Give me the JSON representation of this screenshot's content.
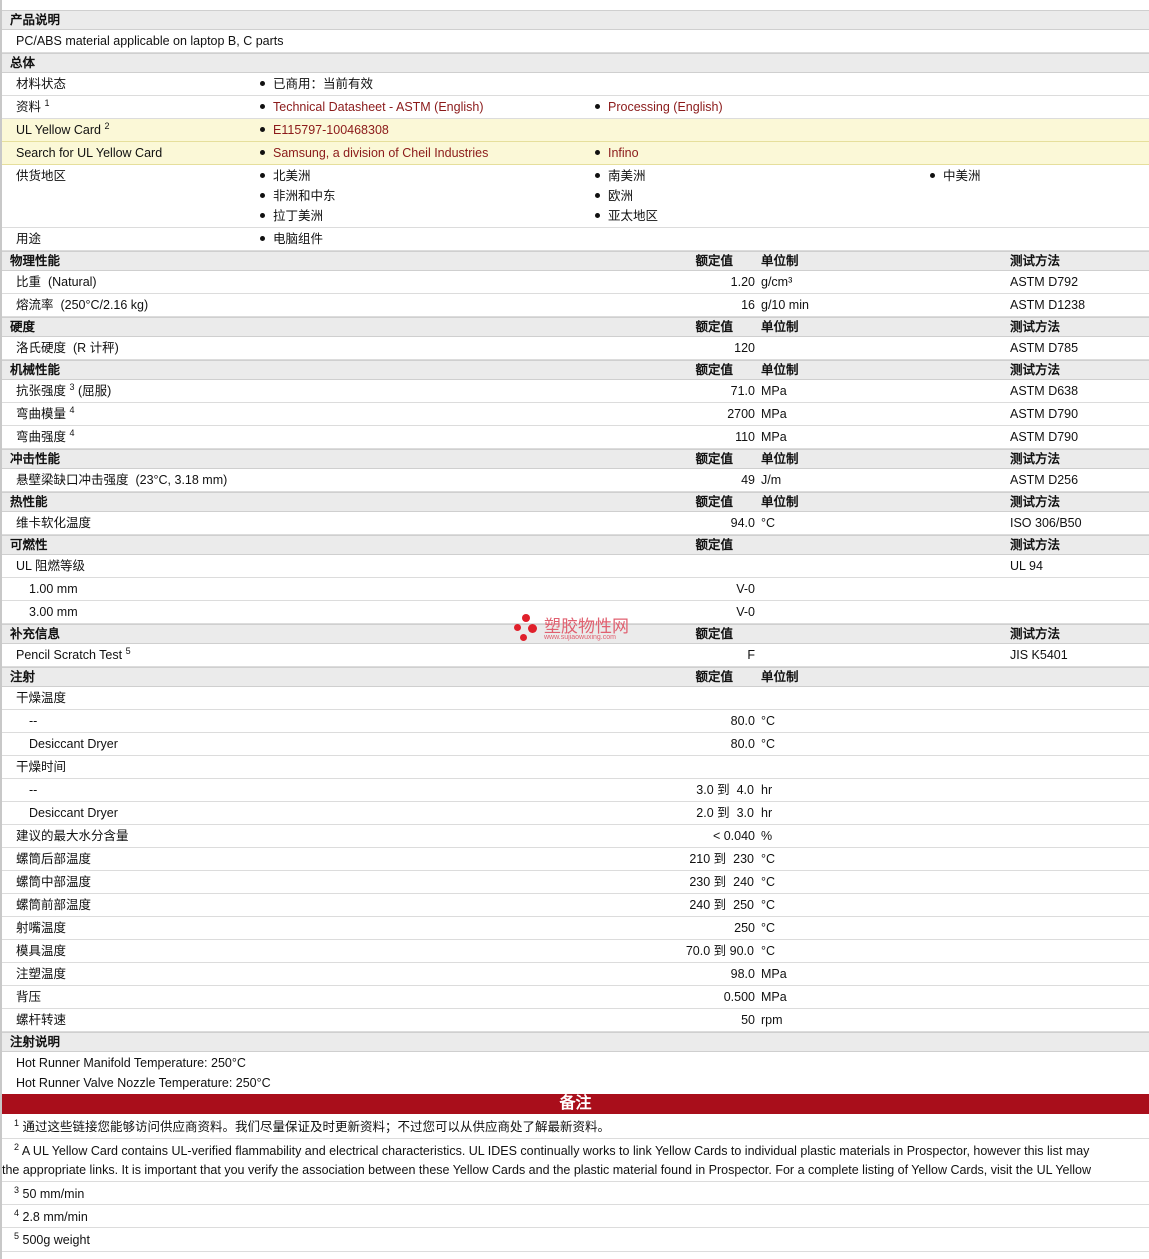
{
  "sections": {
    "desc": "产品说明",
    "general": "总体",
    "physical": "物理性能",
    "hardness": "硬度",
    "mechanical": "机械性能",
    "impact": "冲击性能",
    "thermal": "热性能",
    "flammability": "可燃性",
    "supplement": "补充信息",
    "injection": "注射",
    "injection_notes": "注射说明"
  },
  "headers": {
    "nominal": "额定值",
    "unit": "单位制",
    "method": "测试方法"
  },
  "desc_text": "PC/ABS material applicable on laptop B, C parts",
  "general": {
    "status_label": "材料状态",
    "status_value": "已商用：当前有效",
    "docs_label": "资料",
    "docs_sup": "1",
    "docs_links": [
      "Technical Datasheet - ASTM (English)",
      "Processing (English)"
    ],
    "ul_label": "UL Yellow Card",
    "ul_sup": "2",
    "ul_value": "E115797-100468308",
    "search_label": "Search for UL Yellow Card",
    "search_links": [
      "Samsung, a division of Cheil Industries",
      "Infino"
    ],
    "region_label": "供货地区",
    "regions": [
      "北美洲",
      "南美洲",
      "中美洲",
      "非洲和中东",
      "欧洲",
      "拉丁美洲",
      "亚太地区"
    ],
    "use_label": "用途",
    "use_value": "电脑组件"
  },
  "physical": [
    {
      "label": "比重",
      "cond": "(Natural)",
      "value": "1.20",
      "unit": "g/cm³",
      "method": "ASTM D792"
    },
    {
      "label": "熔流率",
      "cond": "(250°C/2.16 kg)",
      "value": "16",
      "unit": "g/10 min",
      "method": "ASTM D1238"
    }
  ],
  "hardness": [
    {
      "label": "洛氏硬度",
      "cond": "(R 计秤)",
      "value": "120",
      "unit": "",
      "method": "ASTM D785"
    }
  ],
  "mechanical": [
    {
      "label": "抗张强度",
      "sup": "3",
      "cond": "(屈服)",
      "value": "71.0",
      "unit": "MPa",
      "method": "ASTM D638"
    },
    {
      "label": "弯曲模量",
      "sup": "4",
      "value": "2700",
      "unit": "MPa",
      "method": "ASTM D790"
    },
    {
      "label": "弯曲强度",
      "sup": "4",
      "value": "110",
      "unit": "MPa",
      "method": "ASTM D790"
    }
  ],
  "impact": [
    {
      "label": "悬壁梁缺口冲击强度",
      "cond": "(23°C, 3.18 mm)",
      "value": "49",
      "unit": "J/m",
      "method": "ASTM D256"
    }
  ],
  "thermal": [
    {
      "label": "维卡软化温度",
      "value": "94.0",
      "unit": "°C",
      "method": "ISO 306/B50"
    }
  ],
  "flammability": {
    "label": "UL 阻燃等级",
    "method": "UL 94",
    "rows": [
      {
        "label": "1.00 mm",
        "value": "V-0"
      },
      {
        "label": "3.00 mm",
        "value": "V-0"
      }
    ]
  },
  "supplement": [
    {
      "label": "Pencil Scratch Test",
      "sup": "5",
      "value": "F",
      "method": "JIS K5401"
    }
  ],
  "injection": {
    "to": "到",
    "dry_temp_label": "干燥温度",
    "dry_temp": [
      {
        "label": "--",
        "value": "80.0",
        "unit": "°C"
      },
      {
        "label": "Desiccant Dryer",
        "value": "80.0",
        "unit": "°C"
      }
    ],
    "dry_time_label": "干燥时间",
    "dry_time": [
      {
        "label": "--",
        "from": "3.0",
        "upto": "4.0",
        "unit": "hr"
      },
      {
        "label": "Desiccant Dryer",
        "from": "2.0",
        "upto": "3.0",
        "unit": "hr"
      }
    ],
    "moisture": {
      "label": "建议的最大水分含量",
      "value": "< 0.040",
      "unit": "%"
    },
    "rear": {
      "label": "螺筒后部温度",
      "from": "210",
      "upto": "230",
      "unit": "°C"
    },
    "middle": {
      "label": "螺筒中部温度",
      "from": "230",
      "upto": "240",
      "unit": "°C"
    },
    "front": {
      "label": "螺筒前部温度",
      "from": "240",
      "upto": "250",
      "unit": "°C"
    },
    "nozzle": {
      "label": "射嘴温度",
      "value": "250",
      "unit": "°C"
    },
    "mold": {
      "label": "模具温度",
      "from": "70.0",
      "upto": "90.0",
      "unit": "°C"
    },
    "pressure": {
      "label": "注塑温度",
      "value": "98.0",
      "unit": "MPa"
    },
    "back": {
      "label": "背压",
      "value": "0.500",
      "unit": "MPa"
    },
    "speed": {
      "label": "螺杆转速",
      "value": "50",
      "unit": "rpm"
    }
  },
  "injection_notes": [
    "Hot Runner Manifold Temperature: 250°C",
    "Hot Runner Valve Nozzle Temperature: 250°C"
  ],
  "notes_title": "备注",
  "notes": [
    {
      "num": "1",
      "text": "通过这些链接您能够访问供应商资料。我们尽量保证及时更新资料；不过您可以从供应商处了解最新资料。"
    },
    {
      "num": "2",
      "text": "A UL Yellow Card contains UL-verified flammability and electrical characteristics. UL IDES continually works to link Yellow Cards to individual plastic materials in Prospector, however this list may",
      "text2": "the appropriate links. It is important that you verify the association between these Yellow Cards and the plastic material found in Prospector. For a complete listing of Yellow Cards, visit the UL Yellow"
    },
    {
      "num": "3",
      "text": "50 mm/min"
    },
    {
      "num": "4",
      "text": "2.8 mm/min"
    },
    {
      "num": "5",
      "text": "500g weight"
    }
  ],
  "watermark": {
    "name": "塑胶物性网",
    "url": "www.sujiaowuxing.com"
  },
  "colors": {
    "section_bg": "#ebebeb",
    "yellow_row": "#fbf8d7",
    "link": "#8b1a1a",
    "notes_bar": "#a90e1b"
  }
}
